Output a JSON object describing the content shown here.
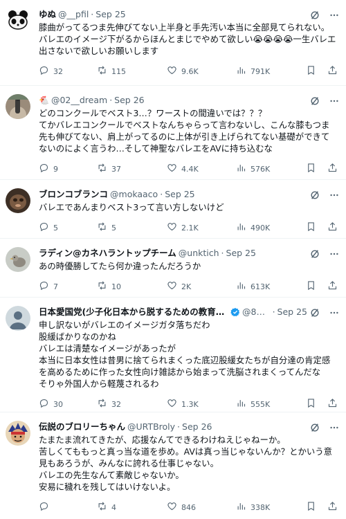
{
  "tweets": [
    {
      "name": "ゆぬ",
      "handle": "@__pfil",
      "date": "Sep 25",
      "text": "膝曲がってるつま先伸びてない上半身と手先汚い本当に全部見てられない。\nバレエのイメージ下がるからほんとまじでやめて欲しい😭😭😭😭一生バレエ出さないで欲しいお願いします",
      "replies": "32",
      "retweets": "115",
      "likes": "9.6K",
      "views": "791K",
      "verified": false
    },
    {
      "name": "",
      "handle": "@02__dream",
      "date": "Sep 26",
      "text": "どのコンクールでベスト3…？ワーストの間違いでは？？？\nてかバレエコンクールでベストなんちゃらって言わないし、こんな膝もつま先も伸びてない、肩上がってるのに上体が引き上げられてない基礎ができてないのによく言うわ…そして神聖なバレエをAVに持ち込むな",
      "replies": "9",
      "retweets": "37",
      "likes": "4.4K",
      "views": "576K",
      "verified": false
    },
    {
      "name": "ブロンコブランコ",
      "handle": "@mokaaco",
      "date": "Sep 25",
      "text": "バレエであんまりベスト3って言い方しないけど",
      "replies": "5",
      "retweets": "5",
      "likes": "2.1K",
      "views": "490K",
      "verified": false
    },
    {
      "name": "ラディン@カネハラントップチーム",
      "handle": "@unktich",
      "date": "Sep 25",
      "text": "あの時優勝してたら何か違ったんだろうか",
      "replies": "7",
      "retweets": "10",
      "likes": "2K",
      "views": "613K",
      "verified": false
    },
    {
      "name": "日本愛国党(少子化日本から脱するための教育の…",
      "handle": "@8Z…",
      "date": "Sep 25",
      "text": "申し訳ないがバレエのイメージガタ落ちだわ\n股緩ばかりなのかね\nバレエは清楚なイメージがあったが\n本当に日本女性は昔男に捨てられまくった底辺股緩女たちが自分達の肯定感を高めるために作った女性向け雑誌から始まって洗脳されまくってんだな\nそりゃ外国人から軽蔑されるわ",
      "replies": "30",
      "retweets": "32",
      "likes": "1.3K",
      "views": "555K",
      "verified": true
    },
    {
      "name": "伝説のブロリーちゃん",
      "handle": "@URTBroly",
      "date": "Sep 26",
      "text": "たまたま流れてきたが、応援なんてできるわけねえじゃねーか。\n苦しくてももっと真っ当な道を歩め。AVは真っ当じゃないんか？とかいう意見もあろうが、みんなに誇れる仕事じゃない。\nバレエの先生なんて素敵じゃないか。\n安易に穢れを残してはいけないよ。",
      "replies": "",
      "retweets": "4",
      "likes": "846",
      "views": "338K",
      "verified": false
    }
  ],
  "icons": {
    "reply": "reply-icon",
    "retweet": "retweet-icon",
    "like": "heart-icon",
    "views": "views-icon",
    "bookmark": "bookmark-icon",
    "share": "share-icon",
    "grok": "grok-icon",
    "more": "more-icon"
  },
  "colors": {
    "text": "#0f1419",
    "muted": "#536471",
    "divider": "#eff3f4",
    "verified": "#1d9bf0"
  }
}
